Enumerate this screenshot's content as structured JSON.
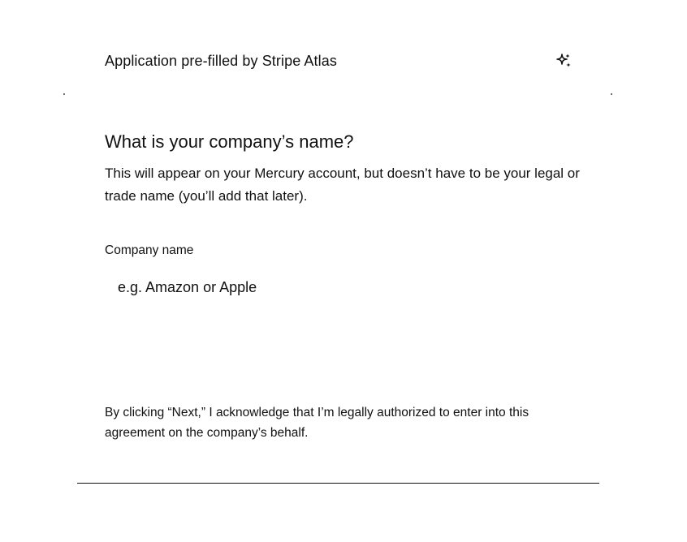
{
  "banner": {
    "text": "Application pre-filled by Stripe Atlas",
    "icon": "sparkle-icon"
  },
  "question": {
    "title": "What is your company’s name?",
    "description": "This will appear on your Mercury account, but doesn’t have to be your legal or trade name (you’ll add that later)."
  },
  "form": {
    "company_name_label": "Company name",
    "company_name_placeholder": "e.g. Amazon or Apple",
    "company_name_value": ""
  },
  "disclaimer": {
    "text": "By clicking “Next,” I acknowledge that I’m legally authorized to enter into this agreement on the company’s behalf."
  }
}
